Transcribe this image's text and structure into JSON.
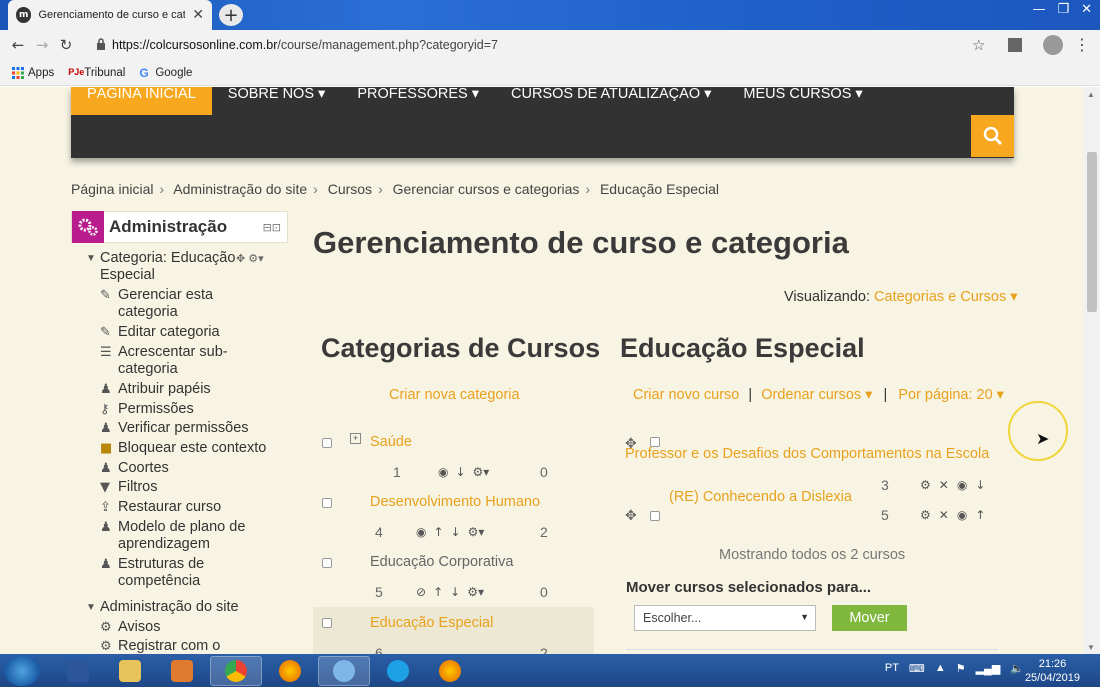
{
  "browser": {
    "tab_title": "Gerenciamento de curso e categ",
    "favicon_text": "m",
    "url_host": "https://colcursosonline.com.br",
    "url_path": "/course/management.php?categoryid=7",
    "bookmarks": [
      {
        "label": "Apps",
        "icon": "apps-grid-icon"
      },
      {
        "label": "Tribunal",
        "icon": "tribunal-icon"
      },
      {
        "label": "Google",
        "icon": "google-icon"
      }
    ]
  },
  "nav": {
    "items": [
      {
        "label": "PÁGINA INICIAL",
        "active": true
      },
      {
        "label": "SOBRE NOS ▾"
      },
      {
        "label": "PROFESSORES ▾"
      },
      {
        "label": "CURSOS DE ATUALIZAÇÃO ▾"
      },
      {
        "label": "MEUS CURSOS ▾"
      }
    ],
    "accent": "#f7a81e",
    "bar_color": "#323232"
  },
  "breadcrumb": [
    "Página inicial",
    "Administração do site",
    "Cursos",
    "Gerenciar cursos e categorias",
    "Educação Especial"
  ],
  "admin": {
    "title": "Administração",
    "tree": [
      {
        "text": "Categoria: Educação Especial",
        "caret": "▼",
        "tools": "✥ ⚙▾"
      },
      {
        "text": "Gerenciar esta categoria",
        "icon": "pencil-icon",
        "glyph": "✎"
      },
      {
        "text": "Editar categoria",
        "icon": "pencil-icon",
        "glyph": "✎"
      },
      {
        "text": "Acrescentar sub-categoria",
        "icon": "list-icon",
        "glyph": "☰"
      },
      {
        "text": "Atribuir papéis",
        "icon": "user-icon",
        "glyph": "♟"
      },
      {
        "text": "Permissões",
        "icon": "key-icon",
        "glyph": "⚷"
      },
      {
        "text": "Verificar permissões",
        "icon": "user-check-icon",
        "glyph": "♟"
      },
      {
        "text": "Bloquear este contexto",
        "icon": "lock-icon",
        "glyph": "🔒"
      },
      {
        "text": "Coortes",
        "icon": "users-icon",
        "glyph": "♟"
      },
      {
        "text": "Filtros",
        "icon": "filter-icon",
        "glyph": "▼"
      },
      {
        "text": "Restaurar curso",
        "icon": "upload-icon",
        "glyph": "⇪"
      },
      {
        "text": "Modelo de plano de aprendizagem",
        "icon": "user-icon",
        "glyph": "♟"
      },
      {
        "text": "Estruturas de competência",
        "icon": "user-icon",
        "glyph": "♟"
      },
      {
        "text": "Administração do site",
        "caret": "▼"
      },
      {
        "text": "Avisos",
        "icon": "gear-icon",
        "glyph": "⚙"
      },
      {
        "text": "Registrar com o",
        "icon": "gear-icon",
        "glyph": "⚙"
      }
    ]
  },
  "main": {
    "title": "Gerenciamento de curso e categoria",
    "viewing_label": "Visualizando:",
    "viewing_value": "Categorias e Cursos ▾",
    "categories_heading": "Categorias de Cursos",
    "new_category": "Criar nova categoria",
    "categories": [
      {
        "name": "Saúde",
        "count": "1",
        "courses": "0",
        "link": true,
        "expand": true
      },
      {
        "name": "Desenvolvimento Humano",
        "count": "4",
        "courses": "2",
        "link": true
      },
      {
        "name": "Educação Corporativa",
        "count": "5",
        "courses": "0",
        "link": false
      },
      {
        "name": "Educação Especial",
        "count": "6",
        "courses": "2",
        "link": true,
        "selected": true
      }
    ],
    "course_heading": "Educação Especial",
    "new_course": "Criar novo curso",
    "sort_courses": "Ordenar cursos ▾",
    "per_page": "Por página: 20 ▾",
    "courses": [
      {
        "name": "Professor e os Desafios dos Comportamentos na Escola",
        "num": "3"
      },
      {
        "name": "(RE) Conhecendo a Dislexia",
        "num": "5"
      }
    ],
    "showing": "Mostrando todos os 2 cursos",
    "move_label": "Mover cursos selecionados para...",
    "select_value": "Escolher...",
    "move_button": "Mover"
  },
  "taskbar": {
    "lang": "PT",
    "time": "21:26",
    "date": "25/04/2019"
  }
}
